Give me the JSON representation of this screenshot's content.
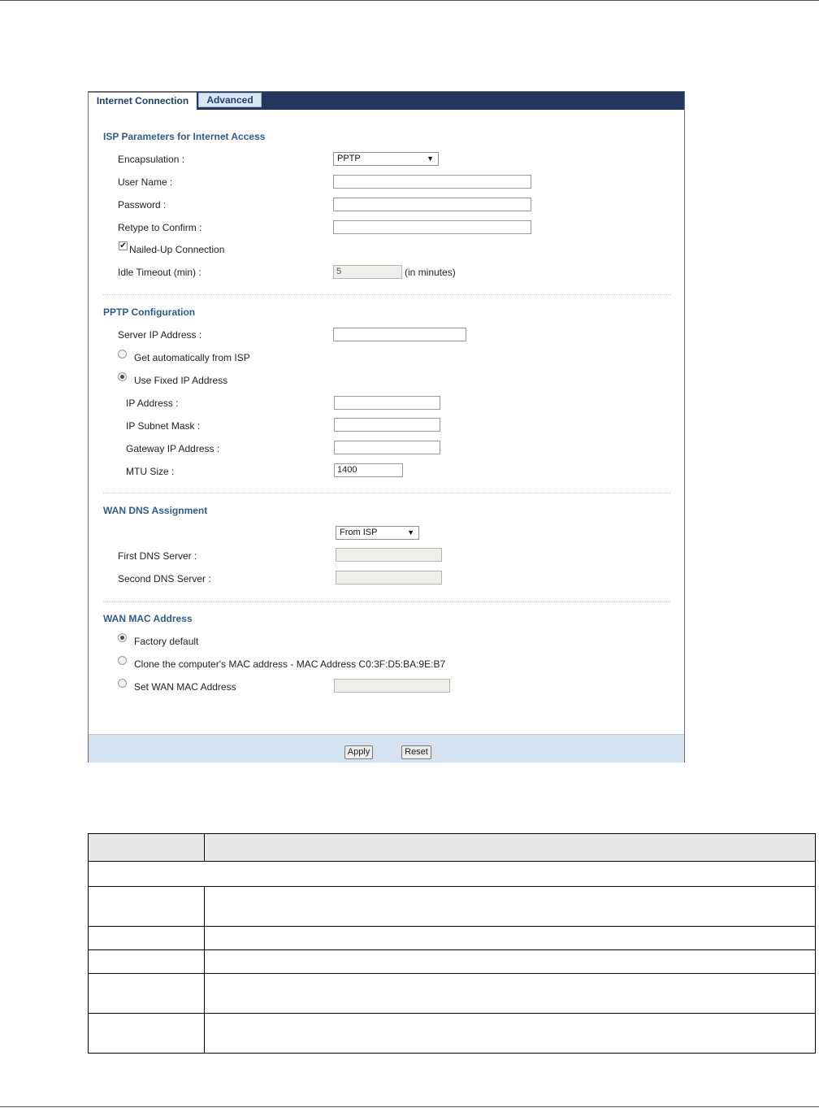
{
  "tabs": [
    {
      "label": "Internet Connection",
      "active": true
    },
    {
      "label": "Advanced",
      "active": false
    }
  ],
  "isp": {
    "title": "ISP Parameters for Internet Access",
    "encapsulation_label": "Encapsulation :",
    "encapsulation_value": "PPTP",
    "username_label": "User Name :",
    "username_value": "",
    "password_label": "Password :",
    "password_value": "",
    "retype_label": "Retype to Confirm :",
    "retype_value": "",
    "nailed_label": "Nailed-Up Connection",
    "nailed_checked": true,
    "idle_label": "Idle Timeout (min) :",
    "idle_value": "5",
    "idle_unit": "(in minutes)"
  },
  "pptp": {
    "title": "PPTP Configuration",
    "server_ip_label": "Server IP Address :",
    "server_ip_value": "",
    "auto_label": "Get automatically from ISP",
    "fixed_label": "Use Fixed IP Address",
    "ip_label": "IP Address :",
    "ip_value": "",
    "mask_label": "IP Subnet Mask :",
    "mask_value": "",
    "gateway_label": "Gateway IP Address :",
    "gateway_value": "",
    "mtu_label": "MTU Size :",
    "mtu_value": "1400"
  },
  "dns": {
    "title": "WAN DNS Assignment",
    "mode_value": "From ISP",
    "first_label": "First DNS Server :",
    "first_value": "",
    "second_label": "Second DNS Server :",
    "second_value": ""
  },
  "mac": {
    "title": "WAN MAC Address",
    "factory_label": "Factory default",
    "clone_label": "Clone the computer's MAC address - MAC Address  C0:3F:D5:BA:9E:B7",
    "set_label": "Set WAN MAC Address",
    "set_value": ""
  },
  "buttons": {
    "apply": "Apply",
    "reset": "Reset"
  }
}
